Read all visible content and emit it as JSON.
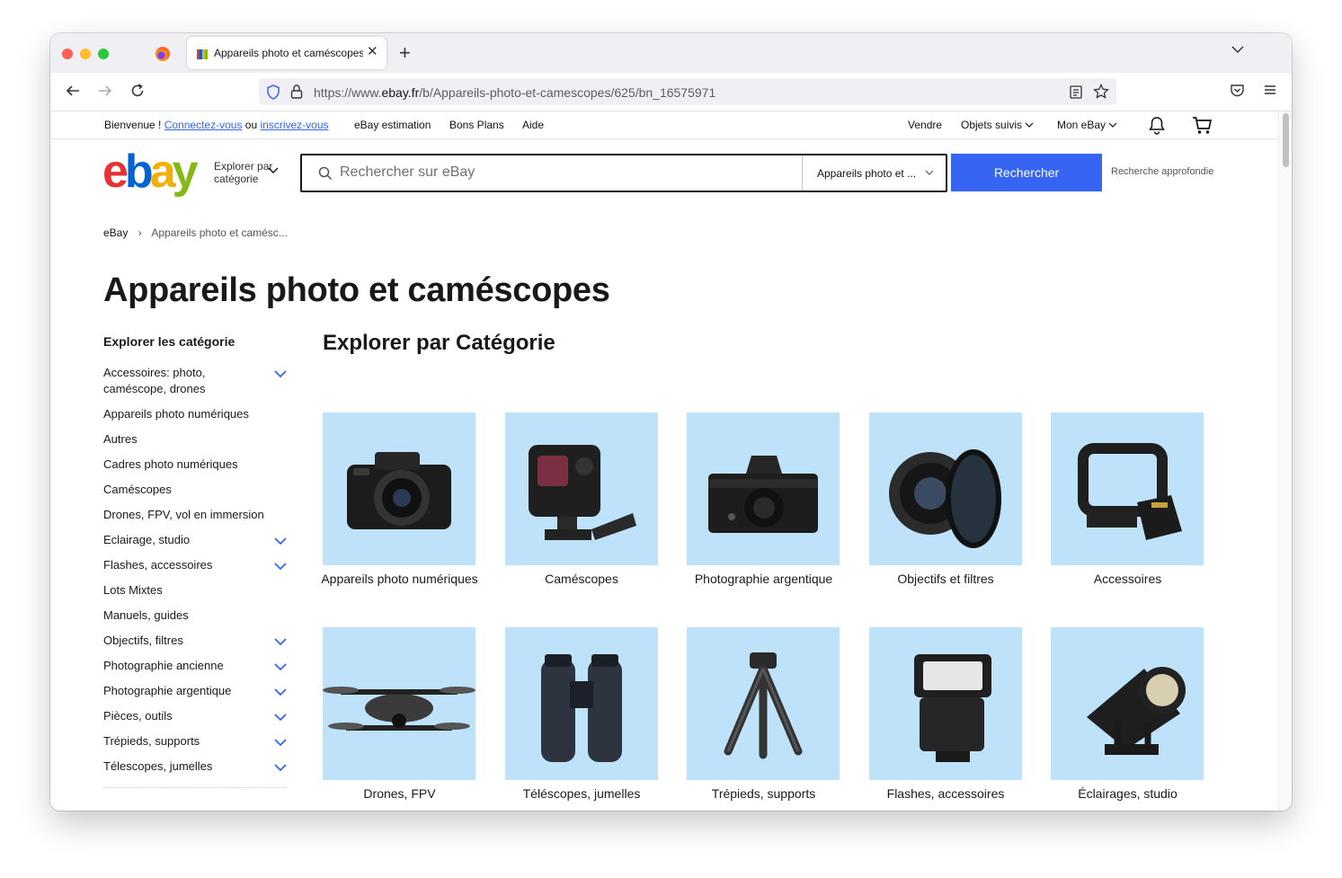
{
  "browser": {
    "tab_title": "Appareils photo et caméscopes",
    "url_prefix": "https://www.",
    "url_domain": "ebay.fr",
    "url_path": "/b/Appareils-photo-et-camescopes/625/bn_16575971"
  },
  "topnav": {
    "welcome": "Bienvenue !",
    "signin": "Connectez-vous",
    "or": "ou",
    "register": "inscrivez-vous",
    "estimation": "eBay estimation",
    "deals": "Bons Plans",
    "help": "Aide",
    "sell": "Vendre",
    "watchlist": "Objets suivis",
    "my_ebay": "Mon eBay"
  },
  "header": {
    "logo_letters": [
      "e",
      "b",
      "a",
      "y"
    ],
    "browse_category": "Explorer par catégorie",
    "search_placeholder": "Rechercher sur eBay",
    "category_select": "Appareils photo et ...",
    "search_button": "Rechercher",
    "advanced": "Recherche approfondie"
  },
  "breadcrumb": {
    "home": "eBay",
    "current": "Appareils photo et camésc..."
  },
  "page_title": "Appareils photo et caméscopes",
  "sidebar": {
    "title": "Explorer les catégorie",
    "items": [
      {
        "label": "Accessoires: photo, caméscope, drones",
        "expandable": true
      },
      {
        "label": "Appareils photo numériques",
        "expandable": false
      },
      {
        "label": "Autres",
        "expandable": false
      },
      {
        "label": "Cadres photo numériques",
        "expandable": false
      },
      {
        "label": "Caméscopes",
        "expandable": false
      },
      {
        "label": "Drones, FPV, vol en immersion",
        "expandable": false
      },
      {
        "label": "Eclairage, studio",
        "expandable": true
      },
      {
        "label": "Flashes, accessoires",
        "expandable": true
      },
      {
        "label": "Lots Mixtes",
        "expandable": false
      },
      {
        "label": "Manuels, guides",
        "expandable": false
      },
      {
        "label": "Objectifs, filtres",
        "expandable": true
      },
      {
        "label": "Photographie ancienne",
        "expandable": true
      },
      {
        "label": "Photographie argentique",
        "expandable": true
      },
      {
        "label": "Pièces, outils",
        "expandable": true
      },
      {
        "label": "Trépieds, supports",
        "expandable": true
      },
      {
        "label": "Télescopes, jumelles",
        "expandable": true
      }
    ]
  },
  "categories": {
    "title": "Explorer par Catégorie",
    "tiles": [
      {
        "label": "Appareils photo numériques",
        "icon": "dslr-camera"
      },
      {
        "label": "Caméscopes",
        "icon": "action-camera"
      },
      {
        "label": "Photographie argentique",
        "icon": "film-camera"
      },
      {
        "label": "Objectifs et filtres",
        "icon": "lens-filter"
      },
      {
        "label": "Accessoires",
        "icon": "camera-cage"
      },
      {
        "label": "Drones, FPV",
        "icon": "drone"
      },
      {
        "label": "Téléscopes, jumelles",
        "icon": "binoculars"
      },
      {
        "label": "Trépieds, supports",
        "icon": "tripod"
      },
      {
        "label": "Flashes, accessoires",
        "icon": "flash"
      },
      {
        "label": "Éclairages, studio",
        "icon": "studio-light"
      }
    ]
  },
  "colors": {
    "logo_e": "#e53238",
    "logo_b": "#0064d2",
    "logo_a": "#f5af02",
    "logo_y": "#86b817",
    "accent": "#3665f3",
    "tile_bg": "#bfe2fb"
  }
}
